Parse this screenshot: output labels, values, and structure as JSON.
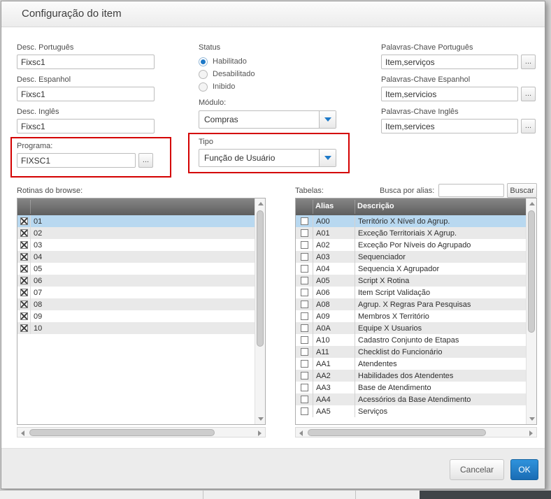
{
  "dialog": {
    "title": "Configuração do item"
  },
  "ui": {
    "ellipsis": "..."
  },
  "colors": {
    "accent_blue": "#1d79c8",
    "selection_blue": "#b8d8f0",
    "highlight_red": "#d40000",
    "table_header_gray": "#6e6e6e"
  },
  "form": {
    "desc_portugues": {
      "label": "Desc. Português",
      "value": "Fixsc1"
    },
    "desc_espanhol": {
      "label": "Desc. Espanhol",
      "value": "Fixsc1"
    },
    "desc_ingles": {
      "label": "Desc. Inglês",
      "value": "Fixsc1"
    },
    "programa": {
      "label": "Programa:",
      "value": "FIXSC1"
    },
    "status": {
      "label": "Status",
      "options": [
        {
          "label": "Habilitado",
          "selected": true
        },
        {
          "label": "Desabilitado",
          "selected": false
        },
        {
          "label": "Inibido",
          "selected": false
        }
      ]
    },
    "modulo": {
      "label": "Módulo:",
      "value": "Compras"
    },
    "tipo": {
      "label": "Tipo",
      "value": "Função de Usuário"
    },
    "palavras_portugues": {
      "label": "Palavras-Chave Português",
      "value": "Item,serviços"
    },
    "palavras_espanhol": {
      "label": "Palavras-Chave Espanhol",
      "value": "Item,servicios"
    },
    "palavras_ingles": {
      "label": "Palavras-Chave Inglês",
      "value": "Item,services"
    }
  },
  "rotinas": {
    "label": "Rotinas do browse:",
    "rows": [
      "01",
      "02",
      "03",
      "04",
      "05",
      "06",
      "07",
      "08",
      "09",
      "10"
    ],
    "selected_index": 0
  },
  "tabelas": {
    "label": "Tabelas:",
    "search_label": "Busca por alias:",
    "search_value": "",
    "buscar_label": "Buscar",
    "columns": [
      "Alias",
      "Descrição"
    ],
    "selected_index": 0,
    "rows": [
      [
        "A00",
        "Território X Nível do Agrup."
      ],
      [
        "A01",
        "Exceção Territoriais X Agrup."
      ],
      [
        "A02",
        "Exceção Por Níveis do Agrupado"
      ],
      [
        "A03",
        "Sequenciador"
      ],
      [
        "A04",
        "Sequencia X Agrupador"
      ],
      [
        "A05",
        "Script X Rotina"
      ],
      [
        "A06",
        "Item Script Validação"
      ],
      [
        "A08",
        "Agrup. X Regras Para Pesquisas"
      ],
      [
        "A09",
        "Membros X Território"
      ],
      [
        "A0A",
        "Equipe X Usuarios"
      ],
      [
        "A10",
        "Cadastro Conjunto de Etapas"
      ],
      [
        "A11",
        "Checklist do Funcionário"
      ],
      [
        "AA1",
        "Atendentes"
      ],
      [
        "AA2",
        "Habilidades dos Atendentes"
      ],
      [
        "AA3",
        "Base de Atendimento"
      ],
      [
        "AA4",
        "Acessórios da Base Atendimento"
      ],
      [
        "AA5",
        "Serviços"
      ]
    ]
  },
  "footer": {
    "cancel": "Cancelar",
    "ok": "OK"
  }
}
